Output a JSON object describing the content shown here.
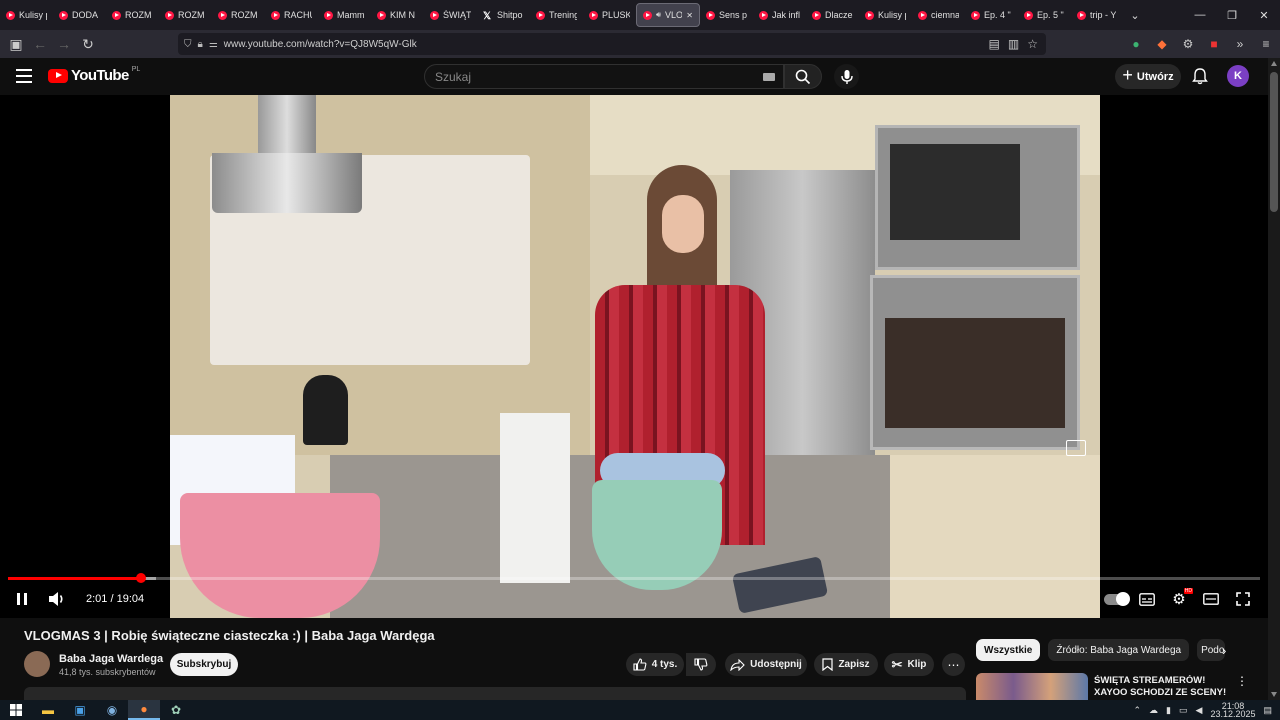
{
  "browser": {
    "tabs": [
      {
        "label": "Kulisy p",
        "icon": "youtube-favicon"
      },
      {
        "label": "DODA",
        "icon": "youtube-favicon"
      },
      {
        "label": "ROZM",
        "icon": "youtube-favicon"
      },
      {
        "label": "ROZM",
        "icon": "youtube-favicon"
      },
      {
        "label": "ROZM",
        "icon": "youtube-favicon"
      },
      {
        "label": "RACHU",
        "icon": "youtube-favicon"
      },
      {
        "label": "Mamm",
        "icon": "youtube-favicon"
      },
      {
        "label": "KIM N",
        "icon": "youtube-favicon"
      },
      {
        "label": "ŚWIĄT",
        "icon": "youtube-favicon"
      },
      {
        "label": "Shitpo",
        "icon": "x-favicon"
      },
      {
        "label": "Trening",
        "icon": "youtube-favicon"
      },
      {
        "label": "PLUSK",
        "icon": "youtube-favicon"
      },
      {
        "label": "VLO",
        "icon": "youtube-favicon",
        "active": true
      },
      {
        "label": "Sens p",
        "icon": "youtube-favicon"
      },
      {
        "label": "Jak infl",
        "icon": "youtube-favicon"
      },
      {
        "label": "Dlacze",
        "icon": "youtube-favicon"
      },
      {
        "label": "Kulisy p",
        "icon": "youtube-favicon"
      },
      {
        "label": "ciemna",
        "icon": "youtube-favicon"
      },
      {
        "label": "Ep. 4 \"",
        "icon": "youtube-favicon"
      },
      {
        "label": "Ep. 5 \"",
        "icon": "youtube-favicon"
      },
      {
        "label": "trip - Y",
        "icon": "youtube-favicon"
      }
    ],
    "url": "www.youtube.com/watch?v=QJ8W5qW-Glk"
  },
  "youtube": {
    "logo_text": "YouTube",
    "country_code": "PL",
    "search_placeholder": "Szukaj",
    "create_label": "Utwórz",
    "avatar_letter": "K",
    "avatar_color": "#7b3fc4"
  },
  "player": {
    "current_time": "2:01",
    "duration": "19:04",
    "time_display": "2:01 / 19:04",
    "played_fraction": 0.106,
    "loaded_fraction": 0.118,
    "hd_badge": "HD",
    "accent_color": "#ff0000"
  },
  "video": {
    "title": "VLOGMAS 3 | Robię świąteczne ciasteczka :) | Baba Jaga Wardęga",
    "channel_name": "Baba Jaga Wardega",
    "subscribers": "41,8 tys. subskrybentów",
    "subscribe_label": "Subskrybuj",
    "likes": "4 tys.",
    "share_label": "Udostępnij",
    "save_label": "Zapisz",
    "clip_label": "Klip"
  },
  "recommendations": {
    "chips": [
      "Wszystkie",
      "Źródło: Baba Jaga Wardega",
      "Podob"
    ],
    "first_title": "ŚWIĘTA STREAMERÓW! XAYOO SCHODZI ZE SCENY!"
  },
  "taskbar": {
    "time": "21:08",
    "date": "23.12.2025"
  }
}
